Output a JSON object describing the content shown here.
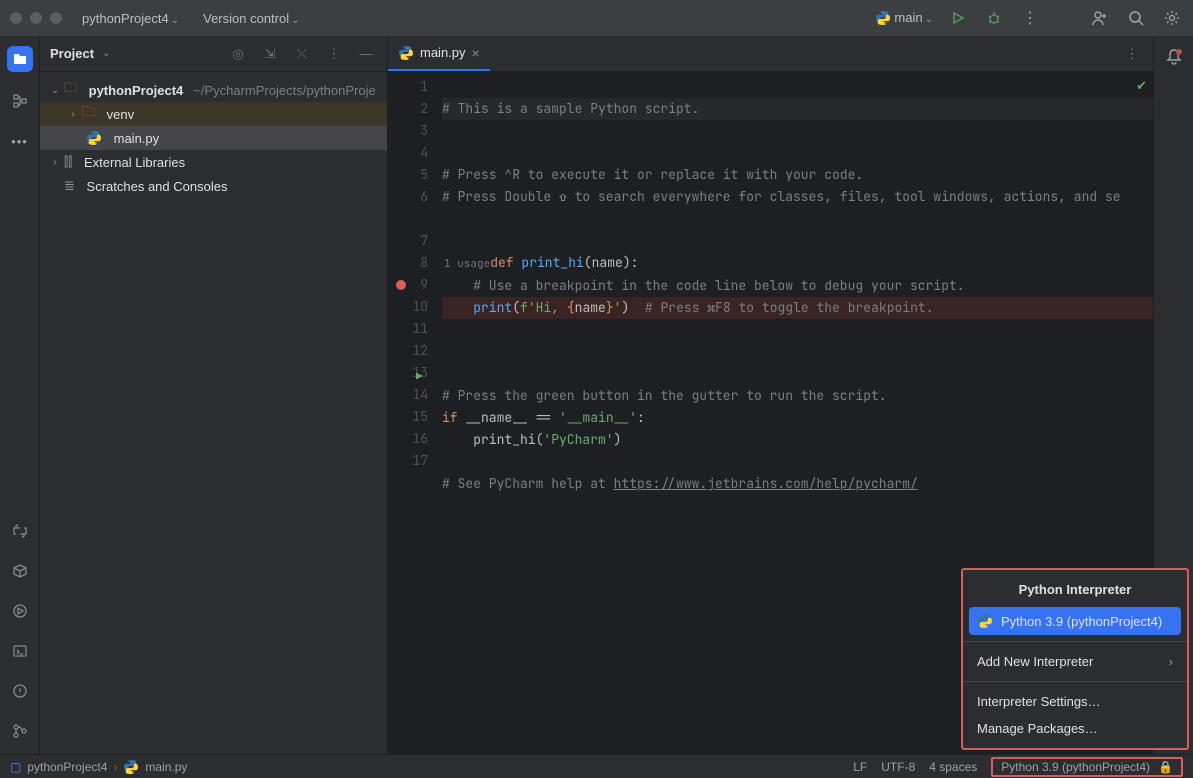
{
  "titlebar": {
    "project": "pythonProject4",
    "vcs": "Version control",
    "runconfig": "main"
  },
  "sidebar": {
    "title": "Project",
    "nodes": {
      "root": "pythonProject4",
      "root_path": "~/PycharmProjects/pythonProje",
      "venv": "venv",
      "mainpy": "main.py",
      "ext": "External Libraries",
      "scratch": "Scratches and Consoles"
    }
  },
  "tab": {
    "name": "main.py"
  },
  "gutter": {
    "usage_label": "1 usage"
  },
  "code": {
    "l1": "# This is a sample Python script.",
    "l3": "# Press ^R to execute it or replace it with your code.",
    "l4": "# Press Double ⇧ to search everywhere for classes, files, tool windows, actions, and se",
    "l7_def": "def ",
    "l7_fn": "print_hi",
    "l7_rest": "(name):",
    "l8": "    # Use a breakpoint in the code line below to debug your script.",
    "l9_a": "    ",
    "l9_print": "print",
    "l9_b": "(",
    "l9_f": "f'Hi, ",
    "l9_br1": "{",
    "l9_name": "name",
    "l9_br2": "}",
    "l9_c": "'",
    "l9_d": ")  ",
    "l9_com": "# Press ⌘F8 to toggle the breakpoint.",
    "l12": "# Press the green button in the gutter to run the script.",
    "l13_if": "if ",
    "l13_name": "__name__ == ",
    "l13_main": "'__main__'",
    "l13_colon": ":",
    "l14_a": "    print_hi(",
    "l14_s": "'PyCharm'",
    "l14_b": ")",
    "l16_a": "# See PyCharm help at ",
    "l16_url": "https://www.jetbrains.com/help/pycharm/"
  },
  "popup": {
    "title": "Python Interpreter",
    "selected": "Python 3.9 (pythonProject4)",
    "add": "Add New Interpreter",
    "settings": "Interpreter Settings…",
    "packages": "Manage Packages…"
  },
  "status": {
    "crumb1": "pythonProject4",
    "crumb2": "main.py",
    "lf": "LF",
    "enc": "UTF-8",
    "indent": "4 spaces",
    "interp": "Python 3.9 (pythonProject4)"
  }
}
